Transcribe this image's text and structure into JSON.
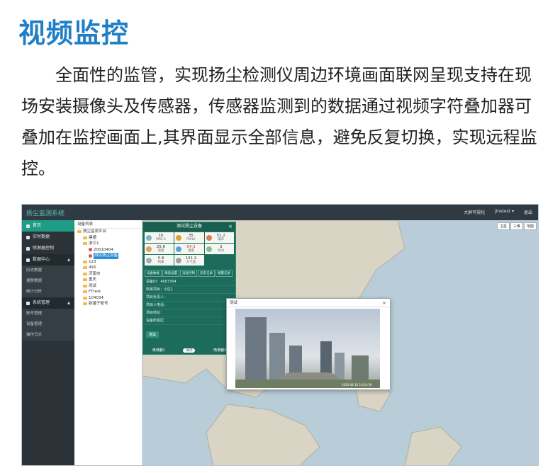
{
  "heading": "视频监控",
  "description": "全面性的监管，实现扬尘检测仪周边环境画面联网呈现支持在现场安装摄像头及传感器，传感器监测到的数据通过视频字符叠加器可叠加在监控画面上,其界面显示全部信息，避免反复切换，实现远程监控。",
  "screenshot": {
    "app_title": "扬尘监测系统",
    "top_right": [
      "大屏可视化",
      "jinstest ▾",
      "退出"
    ],
    "sidebar": [
      {
        "label": "首页",
        "type": "active"
      },
      {
        "label": "实时数据",
        "type": "item"
      },
      {
        "label": "喷淋器控制",
        "type": "item"
      },
      {
        "label": "数据中心",
        "type": "group"
      },
      {
        "label": "历史数据",
        "type": "sub"
      },
      {
        "label": "报警数据",
        "type": "sub"
      },
      {
        "label": "统计分析",
        "type": "sub"
      },
      {
        "label": "系统管理",
        "type": "group"
      },
      {
        "label": "账号管理",
        "type": "sub"
      },
      {
        "label": "设备管理",
        "type": "sub"
      },
      {
        "label": "操作日志",
        "type": "sub"
      }
    ],
    "tree_header": "设备列表",
    "tree": [
      {
        "label": "扬尘监测平台",
        "indent": 4
      },
      {
        "label": "建德",
        "indent": 12
      },
      {
        "label": "浙江1",
        "indent": 12
      },
      {
        "label": "20010404",
        "indent": 20
      },
      {
        "label": "测试扬尘设备",
        "indent": 20,
        "selected": true
      },
      {
        "label": "123",
        "indent": 12
      },
      {
        "label": "456",
        "indent": 12
      },
      {
        "label": "济南市",
        "indent": 12
      },
      {
        "label": "重庆",
        "indent": 12
      },
      {
        "label": "测试",
        "indent": 12
      },
      {
        "label": "FTtest",
        "indent": 12
      },
      {
        "label": "104034",
        "indent": 12
      },
      {
        "label": "新疆子账号",
        "indent": 12
      }
    ],
    "map_tools": [
      "卫星",
      "三维",
      "地图"
    ],
    "device_panel": {
      "title": "测试扬尘设备",
      "sensors": [
        {
          "value": "16",
          "label": "PM2.5",
          "color": "#7fb3d5",
          "red": false
        },
        {
          "value": "35",
          "label": "PM10",
          "color": "#d4a23a",
          "red": false
        },
        {
          "value": "51.2",
          "label": "噪声",
          "color": "#e07a5f",
          "red": false
        },
        {
          "value": "25.6",
          "label": "温度",
          "color": "#e0a060",
          "red": false
        },
        {
          "value": "64.3",
          "label": "湿度",
          "color": "#5aa0d8",
          "red": true
        },
        {
          "value": "3",
          "label": "风力",
          "color": "#8fb996",
          "red": false
        },
        {
          "value": "5.8",
          "label": "风速",
          "color": "#9ab0c0",
          "red": false
        },
        {
          "value": "101.2",
          "label": "大气压",
          "color": "#a0a0a0",
          "red": false
        }
      ],
      "tabs": [
        "设备数据",
        "阈值设置",
        "远程控制",
        "历史记录",
        "报警记录"
      ],
      "rows": [
        "设备ID：4007304",
        "所属项目：小区1",
        "项目负责人：",
        "项目人电话：",
        "项目地址：",
        "设备所属区："
      ],
      "test_button": "测试",
      "footer_left": "喷淋器1",
      "toggle": "关闭",
      "footer_right": "喷淋器2"
    },
    "video_window": {
      "title": "测试",
      "caption": "2020-04-16 10:54:39"
    }
  }
}
